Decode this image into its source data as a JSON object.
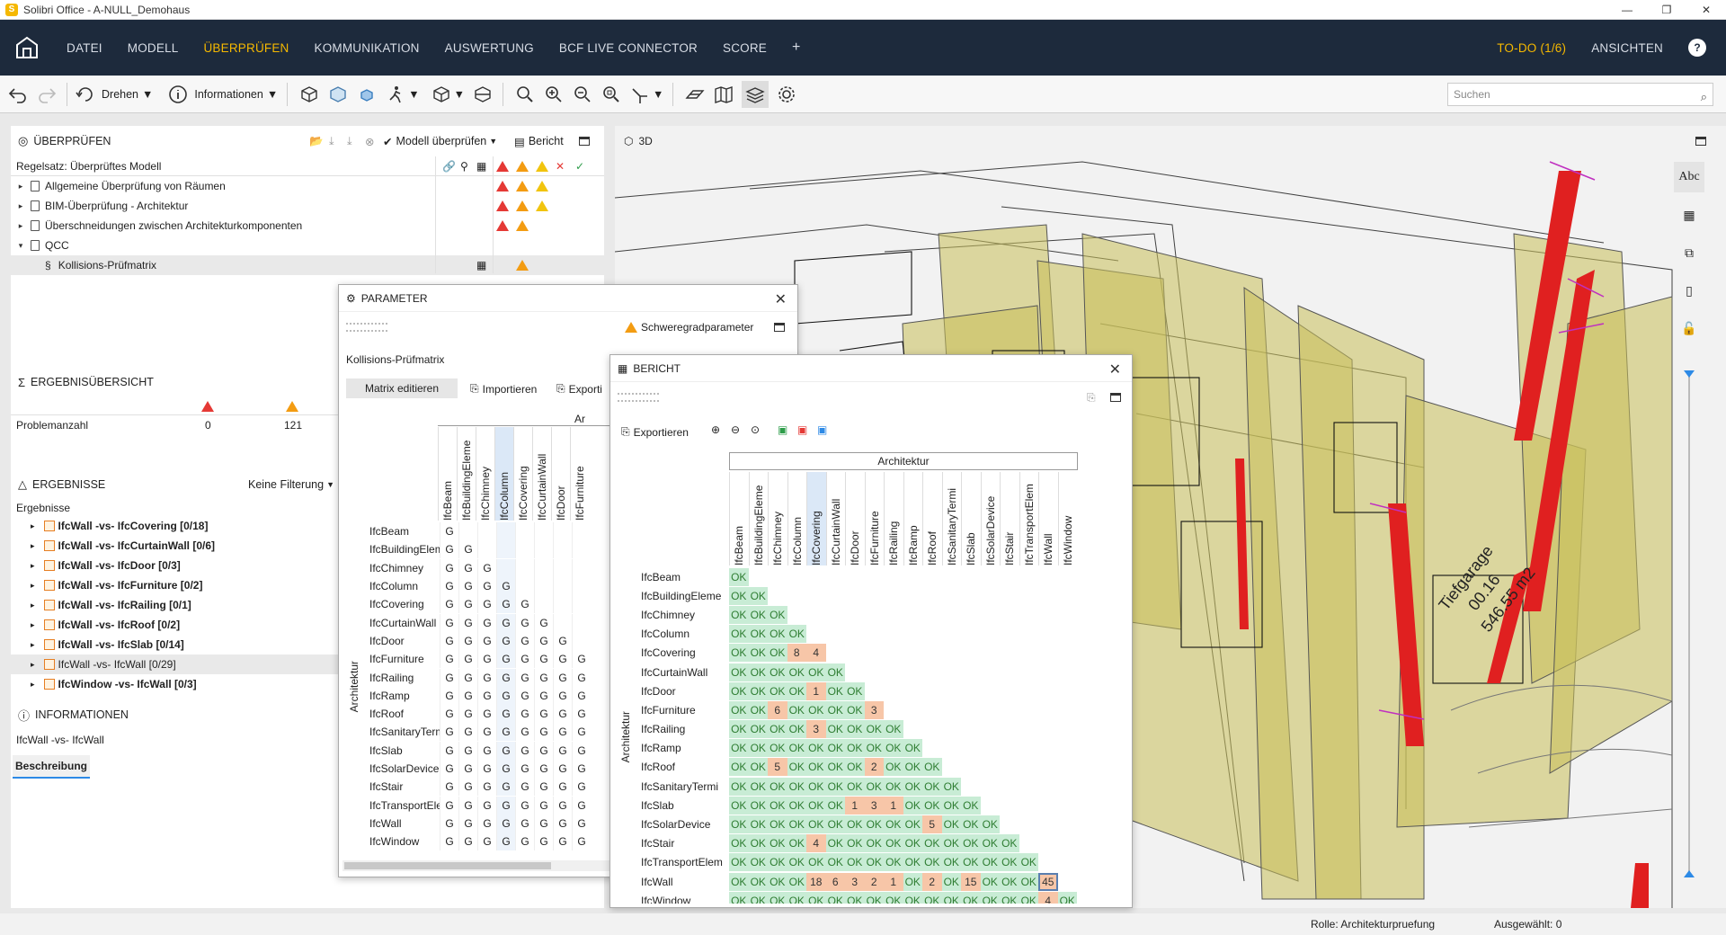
{
  "window": {
    "title": "Solibri Office - A-NULL_Demohaus",
    "logo": "S"
  },
  "menu": {
    "items": [
      "DATEI",
      "MODELL",
      "ÜBERPRÜFEN",
      "KOMMUNIKATION",
      "AUSWERTUNG",
      "BCF LIVE CONNECTOR",
      "SCORE"
    ],
    "plus": "+",
    "todo": "TO-DO (1/6)",
    "views": "ANSICHTEN",
    "help": "?"
  },
  "toolbar": {
    "rotate": "Drehen",
    "info": "Informationen",
    "search_placeholder": "Suchen"
  },
  "check_panel": {
    "title": "ÜBERPRÜFEN",
    "model_check": "Modell überprüfen",
    "report": "Bericht",
    "ruleset": "Regelsatz: Überprüftes Modell",
    "rows": [
      {
        "label": "Allgemeine Überprüfung von Räumen",
        "arrow": "▸"
      },
      {
        "label": "BIM-Überprüfung - Architektur",
        "arrow": "▸"
      },
      {
        "label": "Überschneidungen zwischen Architekturkomponenten",
        "arrow": "▸"
      },
      {
        "label": "QCC",
        "arrow": "▾"
      },
      {
        "label": "Kollisions-Prüfmatrix",
        "arrow": "§"
      }
    ]
  },
  "summary": {
    "title": "ERGEBNISÜBERSICHT",
    "label": "Problemanzahl",
    "critical": "0",
    "moderate": "121"
  },
  "results": {
    "title": "ERGEBNISSE",
    "filter": "Keine Filterung",
    "header": "Ergebnisse",
    "items": [
      "IfcWall -vs- IfcCovering [0/18]",
      "IfcWall -vs- IfcCurtainWall [0/6]",
      "IfcWall -vs- IfcDoor [0/3]",
      "IfcWall -vs- IfcFurniture [0/2]",
      "IfcWall -vs- IfcRailing [0/1]",
      "IfcWall -vs- IfcRoof [0/2]",
      "IfcWall -vs- IfcSlab [0/14]",
      "IfcWall -vs- IfcWall [0/29]",
      "IfcWindow -vs- IfcWall [0/3]"
    ]
  },
  "info_panel": {
    "title": "INFORMATIONEN",
    "subject": "IfcWall -vs- IfcWall",
    "tab": "Beschreibung"
  },
  "view3d": {
    "label": "3D",
    "room_name": "Tiefgarage",
    "room_num": "00.16",
    "room_area": "546.55 m2"
  },
  "param_dialog": {
    "title": "PARAMETER",
    "severity": "Schweregradparameter",
    "rule": "Kollisions-Prüfmatrix",
    "edit": "Matrix editieren",
    "import": "Importieren",
    "export": "Exporti",
    "group": "Ar",
    "side_label": "Architektur",
    "cols": [
      "IfcBeam",
      "IfcBuildingEleme",
      "IfcChimney",
      "IfcColumn",
      "IfcCovering",
      "IfcCurtainWall",
      "IfcDoor",
      "IfcFurniture"
    ],
    "rows": [
      "IfcBeam",
      "IfcBuildingEleme",
      "IfcChimney",
      "IfcColumn",
      "IfcCovering",
      "IfcCurtainWall",
      "IfcDoor",
      "IfcFurniture",
      "IfcRailing",
      "IfcRamp",
      "IfcRoof",
      "IfcSanitaryTermi",
      "IfcSlab",
      "IfcSolarDevice",
      "IfcStair",
      "IfcTransportElem",
      "IfcWall",
      "IfcWindow"
    ],
    "cell": "G"
  },
  "report_dialog": {
    "title": "BERICHT",
    "export": "Exportieren",
    "group": "Architektur",
    "side_label": "Architektur",
    "cols": [
      "IfcBeam",
      "IfcBuildingEleme",
      "IfcChimney",
      "IfcColumn",
      "IfcCovering",
      "IfcCurtainWall",
      "IfcDoor",
      "IfcFurniture",
      "IfcRailing",
      "IfcRamp",
      "IfcRoof",
      "IfcSanitaryTermi",
      "IfcSlab",
      "IfcSolarDevice",
      "IfcStair",
      "IfcTransportElem",
      "IfcWall",
      "IfcWindow"
    ],
    "rows": [
      "IfcBeam",
      "IfcBuildingEleme",
      "IfcChimney",
      "IfcColumn",
      "IfcCovering",
      "IfcCurtainWall",
      "IfcDoor",
      "IfcFurniture",
      "IfcRailing",
      "IfcRamp",
      "IfcRoof",
      "IfcSanitaryTermi",
      "IfcSlab",
      "IfcSolarDevice",
      "IfcStair",
      "IfcTransportElem",
      "IfcWall",
      "IfcWindow"
    ],
    "cells": [
      [
        "OK"
      ],
      [
        "OK",
        "OK"
      ],
      [
        "OK",
        "OK",
        "OK"
      ],
      [
        "OK",
        "OK",
        "OK",
        "OK"
      ],
      [
        "OK",
        "OK",
        "OK",
        "8",
        "4"
      ],
      [
        "OK",
        "OK",
        "OK",
        "OK",
        "OK",
        "OK"
      ],
      [
        "OK",
        "OK",
        "OK",
        "OK",
        "1",
        "OK",
        "OK"
      ],
      [
        "OK",
        "OK",
        "6",
        "OK",
        "OK",
        "OK",
        "OK",
        "3"
      ],
      [
        "OK",
        "OK",
        "OK",
        "OK",
        "3",
        "OK",
        "OK",
        "OK",
        "OK"
      ],
      [
        "OK",
        "OK",
        "OK",
        "OK",
        "OK",
        "OK",
        "OK",
        "OK",
        "OK",
        "OK"
      ],
      [
        "OK",
        "OK",
        "5",
        "OK",
        "OK",
        "OK",
        "OK",
        "2",
        "OK",
        "OK",
        "OK"
      ],
      [
        "OK",
        "OK",
        "OK",
        "OK",
        "OK",
        "OK",
        "OK",
        "OK",
        "OK",
        "OK",
        "OK",
        "OK"
      ],
      [
        "OK",
        "OK",
        "OK",
        "OK",
        "OK",
        "OK",
        "1",
        "3",
        "1",
        "OK",
        "OK",
        "OK",
        "OK"
      ],
      [
        "OK",
        "OK",
        "OK",
        "OK",
        "OK",
        "OK",
        "OK",
        "OK",
        "OK",
        "OK",
        "5",
        "OK",
        "OK",
        "OK"
      ],
      [
        "OK",
        "OK",
        "OK",
        "OK",
        "4",
        "OK",
        "OK",
        "OK",
        "OK",
        "OK",
        "OK",
        "OK",
        "OK",
        "OK",
        "OK"
      ],
      [
        "OK",
        "OK",
        "OK",
        "OK",
        "OK",
        "OK",
        "OK",
        "OK",
        "OK",
        "OK",
        "OK",
        "OK",
        "OK",
        "OK",
        "OK",
        "OK"
      ],
      [
        "OK",
        "OK",
        "OK",
        "OK",
        "18",
        "6",
        "3",
        "2",
        "1",
        "OK",
        "2",
        "OK",
        "15",
        "OK",
        "OK",
        "OK",
        "45"
      ],
      [
        "OK",
        "OK",
        "OK",
        "OK",
        "OK",
        "OK",
        "OK",
        "OK",
        "OK",
        "OK",
        "OK",
        "OK",
        "OK",
        "OK",
        "OK",
        "OK",
        "4",
        "OK"
      ]
    ]
  },
  "status": {
    "role": "Rolle: Architekturpruefung",
    "selected": "Ausgewählt: 0"
  },
  "colors": {
    "accent": "#f5b800",
    "menubar": "#1d2a3c",
    "ok": "#c8ecd5",
    "issue": "#f7c6a8",
    "critical": "#e53935",
    "moderate": "#f39c12"
  }
}
